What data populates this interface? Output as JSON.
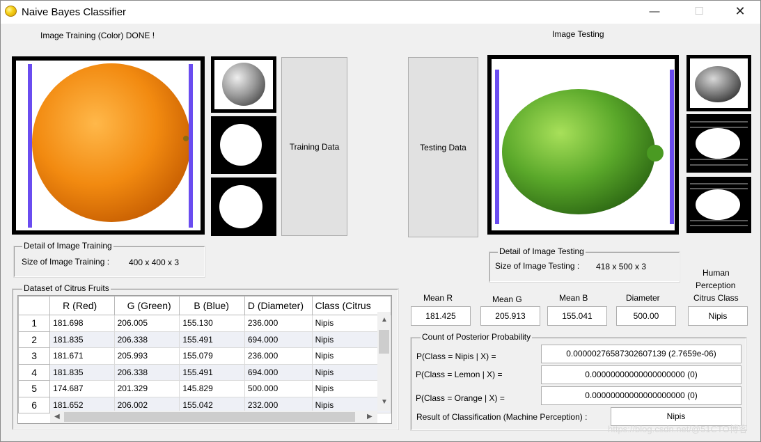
{
  "window": {
    "title": "Naive Bayes Classifier"
  },
  "training": {
    "status": "Image Training (Color) DONE !",
    "button_label": "Training Data",
    "detail_legend": "Detail of Image Training",
    "size_label": "Size of Image Training :",
    "size_value": "400 x 400 x 3"
  },
  "testing": {
    "heading": "Image Testing",
    "button_label": "Testing Data",
    "detail_legend": "Detail of Image Testing",
    "size_label": "Size of Image Testing :",
    "size_value": "418 x 500 x 3"
  },
  "dataset": {
    "legend": "Dataset of Citrus Fruits",
    "columns": [
      "R (Red)",
      "G (Green)",
      "B (Blue)",
      "D (Diameter)",
      "Class (Citrus"
    ],
    "rows": [
      {
        "num": "1",
        "cells": [
          "181.698",
          "206.005",
          "155.130",
          "236.000",
          "Nipis"
        ]
      },
      {
        "num": "2",
        "cells": [
          "181.835",
          "206.338",
          "155.491",
          "694.000",
          "Nipis"
        ]
      },
      {
        "num": "3",
        "cells": [
          "181.671",
          "205.993",
          "155.079",
          "236.000",
          "Nipis"
        ]
      },
      {
        "num": "4",
        "cells": [
          "181.835",
          "206.338",
          "155.491",
          "694.000",
          "Nipis"
        ]
      },
      {
        "num": "5",
        "cells": [
          "174.687",
          "201.329",
          "145.829",
          "500.000",
          "Nipis"
        ]
      },
      {
        "num": "6",
        "cells": [
          "181.652",
          "206.002",
          "155.042",
          "232.000",
          "Nipis"
        ]
      }
    ]
  },
  "features": {
    "mean_r_label": "Mean R",
    "mean_r_value": "181.425",
    "mean_g_label": "Mean G",
    "mean_g_value": "205.913",
    "mean_b_label": "Mean B",
    "mean_b_value": "155.041",
    "diameter_label": "Diameter",
    "diameter_value": "500.00",
    "human_label_1": "Human",
    "human_label_2": "Perception",
    "human_label_3": "Citrus Class",
    "human_value": "Nipis"
  },
  "posterior": {
    "legend": "Count of  Posterior Probability",
    "nipis_label": "P(Class = Nipis | X) =",
    "nipis_value": "0.00000276587302607139  (2.7659e-06)",
    "lemon_label": "P(Class = Lemon | X) =",
    "lemon_value": "0.00000000000000000000  (0)",
    "orange_label": "P(Class = Orange | X) =",
    "orange_value": "0.00000000000000000000  (0)",
    "result_label": "Result of Classification (Machine Perception) :",
    "result_value": "Nipis"
  },
  "watermark": "https://blog.csdn.net/@51CTO博客",
  "colors": {
    "orange": "#f28a10",
    "lime": "#5aa82a",
    "marker": "#6a4cf0"
  }
}
